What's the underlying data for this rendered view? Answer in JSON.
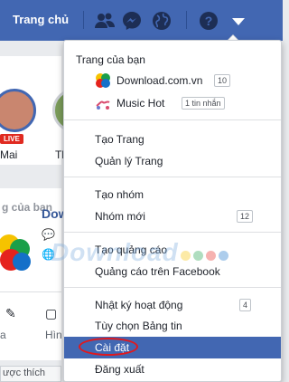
{
  "topbar": {
    "home_label": "Trang chủ",
    "icons": [
      "friends-icon",
      "messenger-icon",
      "globe-icon",
      "help-icon",
      "dropdown-arrow-icon"
    ]
  },
  "background": {
    "story_names": [
      "Mai",
      "Th"
    ],
    "live_label": "LIVE",
    "section_title": "g của bạn",
    "page_name_partial": "Dow",
    "actions": [
      "a",
      "Hìn"
    ],
    "bottom_button": "ược thích"
  },
  "menu": {
    "header": "Trang của bạn",
    "pages": [
      {
        "name": "Download.com.vn",
        "badge": "10",
        "icon": "download-logo-icon"
      },
      {
        "name": "Music Hot",
        "badge": "1 tin nhắn",
        "icon": "music-logo-icon"
      }
    ],
    "groups": [
      [
        {
          "label": "Tạo Trang"
        },
        {
          "label": "Quản lý Trang"
        }
      ],
      [
        {
          "label": "Tạo nhóm"
        },
        {
          "label": "Nhóm mới",
          "badge": "12"
        }
      ],
      [
        {
          "label": "Tạo quảng cáo"
        },
        {
          "label": "Quảng cáo trên Facebook"
        }
      ],
      [
        {
          "label": "Nhật ký hoạt động",
          "badge": "4"
        },
        {
          "label": "Tùy chọn Bảng tin"
        },
        {
          "label": "Cài đặt",
          "active": true
        },
        {
          "label": "Đăng xuất"
        }
      ]
    ]
  },
  "watermark": "Download",
  "colors": {
    "brand": "#4267b2",
    "highlight_ellipse": "#e0191e"
  }
}
